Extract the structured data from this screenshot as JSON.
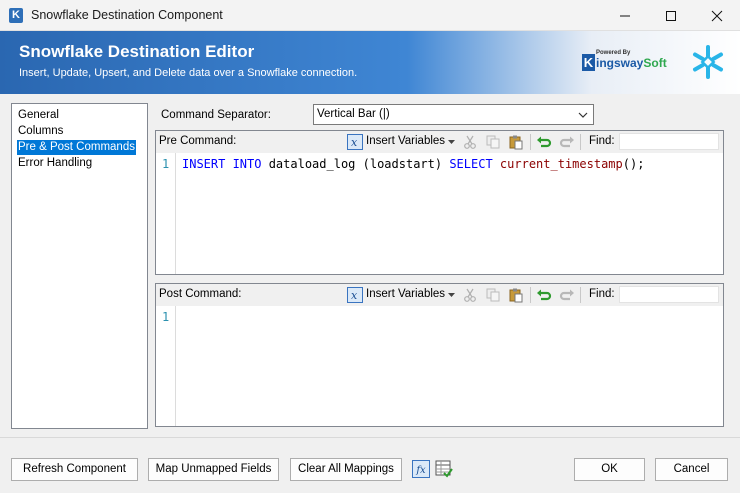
{
  "window": {
    "title": "Snowflake Destination Component",
    "app_icon_letter": "K"
  },
  "header": {
    "title": "Snowflake Destination Editor",
    "subtitle": "Insert, Update, Upsert, and Delete data over a Snowflake connection.",
    "brand_powered": "Powered By",
    "brand_k": "K",
    "brand_name_a": "ingsway",
    "brand_name_b": "Soft"
  },
  "sidebar": {
    "items": [
      {
        "label": "General",
        "selected": false
      },
      {
        "label": "Columns",
        "selected": false
      },
      {
        "label": "Pre & Post Commands",
        "selected": true
      },
      {
        "label": "Error Handling",
        "selected": false
      }
    ]
  },
  "command_separator": {
    "label": "Command Separator:",
    "value": "Vertical Bar (|)"
  },
  "pre_command": {
    "label": "Pre Command:",
    "insert_variables": "Insert Variables",
    "find_label": "Find:",
    "find_value": "",
    "line_number": "1",
    "code_tokens": [
      {
        "text": "INSERT INTO",
        "type": "kw"
      },
      {
        "text": " dataload_log (loadstart) ",
        "type": "plain"
      },
      {
        "text": "SELECT",
        "type": "kw"
      },
      {
        "text": " ",
        "type": "plain"
      },
      {
        "text": "current_timestamp",
        "type": "fn"
      },
      {
        "text": "();",
        "type": "plain"
      }
    ]
  },
  "post_command": {
    "label": "Post Command:",
    "insert_variables": "Insert Variables",
    "find_label": "Find:",
    "find_value": "",
    "line_number": "1",
    "code": ""
  },
  "footer": {
    "refresh": "Refresh Component",
    "map_unmapped": "Map Unmapped Fields",
    "clear_all": "Clear All Mappings",
    "fx_label": "fx",
    "ok": "OK",
    "cancel": "Cancel"
  },
  "colors": {
    "header_start": "#2a67b1",
    "selected_item": "#0078d7",
    "keyword": "#0000ff",
    "function": "#8b0000",
    "line_number": "#2b91af"
  },
  "icons": [
    "app-icon",
    "minimize-icon",
    "maximize-icon",
    "close-icon",
    "snowflake-icon",
    "insert-variable-icon",
    "cut-icon",
    "copy-icon",
    "paste-icon",
    "undo-icon",
    "redo-icon",
    "dropdown-caret-icon",
    "expression-icon",
    "grid-icon"
  ]
}
